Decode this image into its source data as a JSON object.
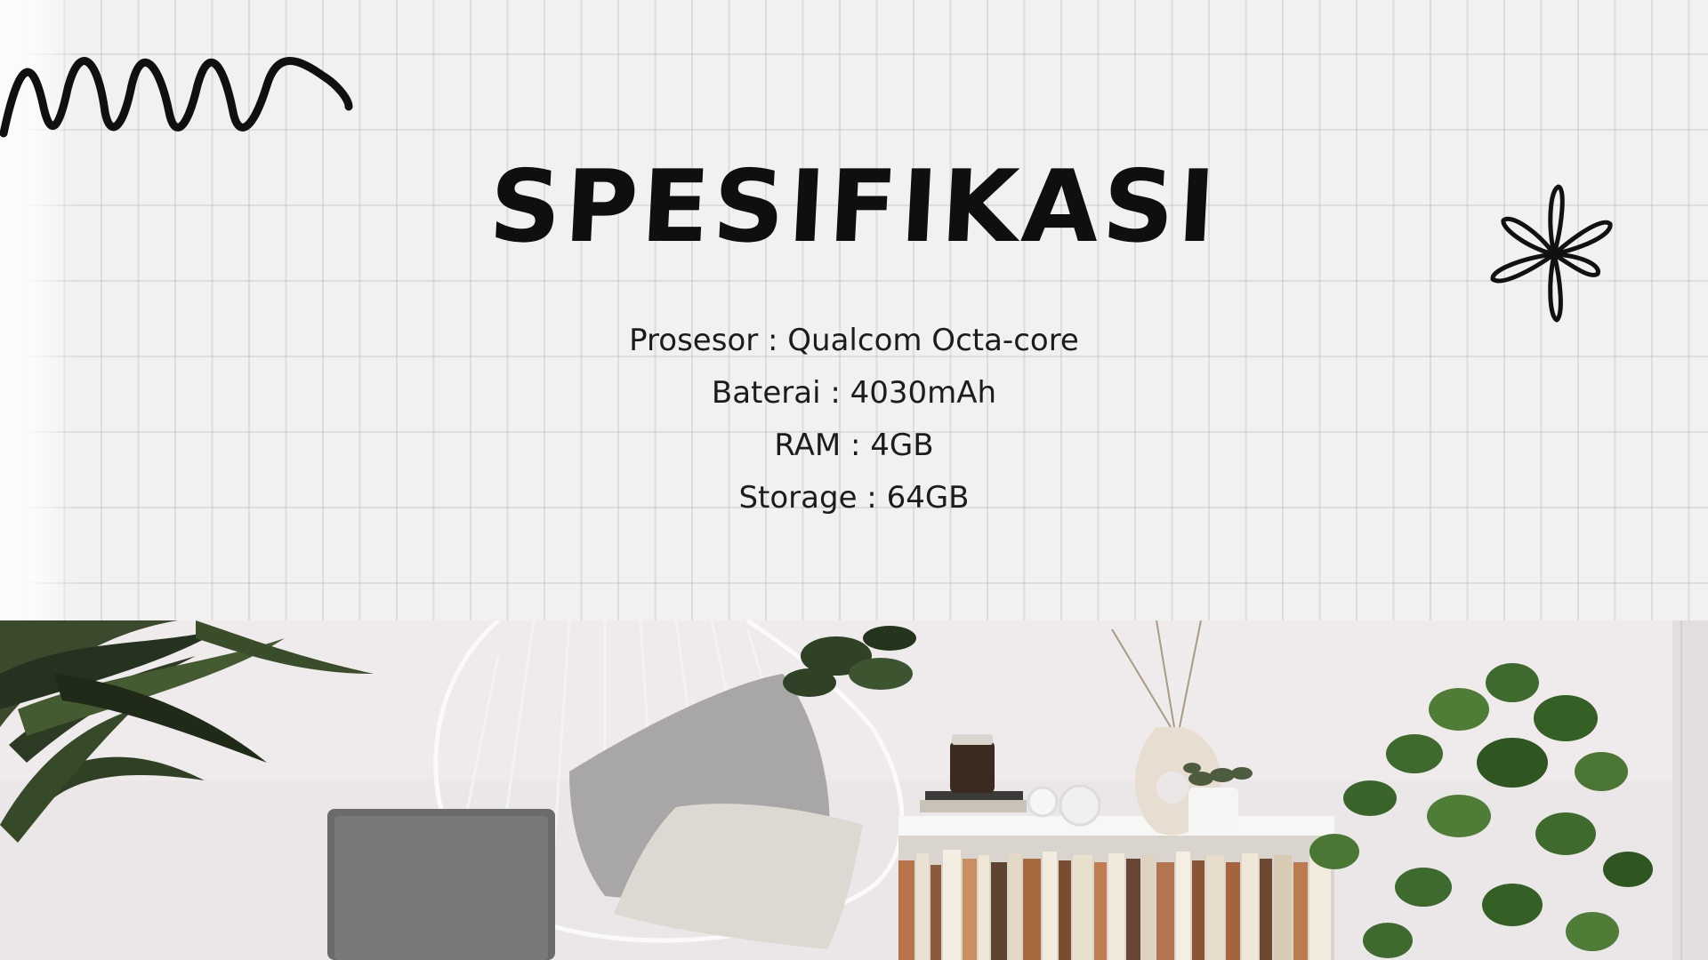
{
  "slide": {
    "title": "SPESIFIKASI",
    "specs": [
      "Prosesor : Qualcom Octa-core",
      "Baterai : 4030mAh",
      "RAM : 4GB",
      "Storage : 64GB"
    ]
  },
  "decorations": {
    "zigzag": "zigzag-doodle",
    "flower": "flower-doodle"
  },
  "photo": {
    "description_icon": "room-photo"
  },
  "colors": {
    "paper": "#f1f1ef",
    "ink": "#0f0f0f"
  }
}
